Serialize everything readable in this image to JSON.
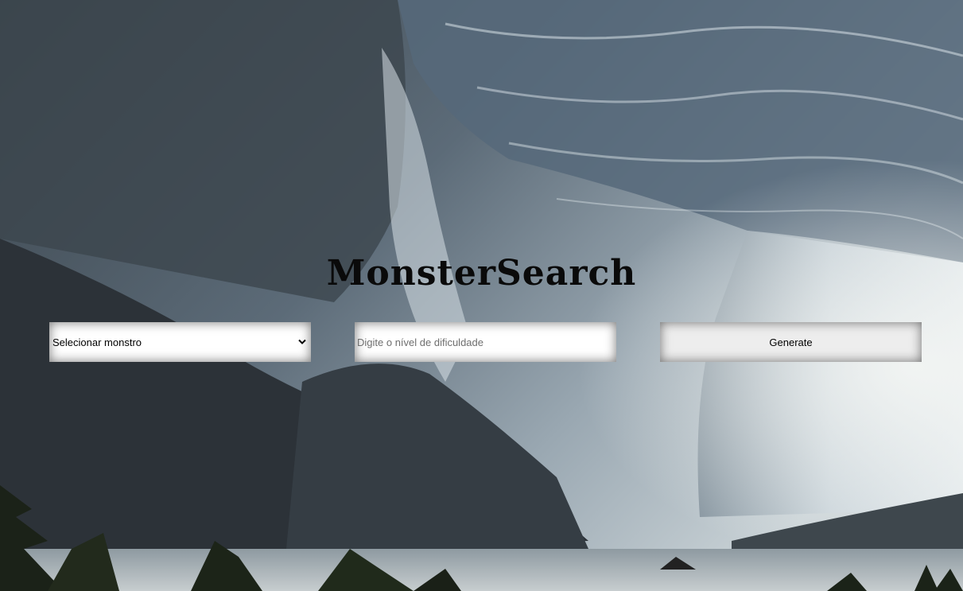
{
  "app": {
    "title": "MonsterSearch"
  },
  "controls": {
    "monster_select": {
      "selected": "Selecionar monstro",
      "options": [
        "Selecionar monstro"
      ]
    },
    "difficulty_input": {
      "value": "",
      "placeholder": "Digite o nível de dificuldade"
    },
    "generate_label": "Generate"
  },
  "icons": {
    "select_arrow": "chevron-down-icon"
  },
  "colors": {
    "title": "#0a0a0a",
    "button_bg": "#ededed",
    "field_bg": "#ffffff"
  }
}
